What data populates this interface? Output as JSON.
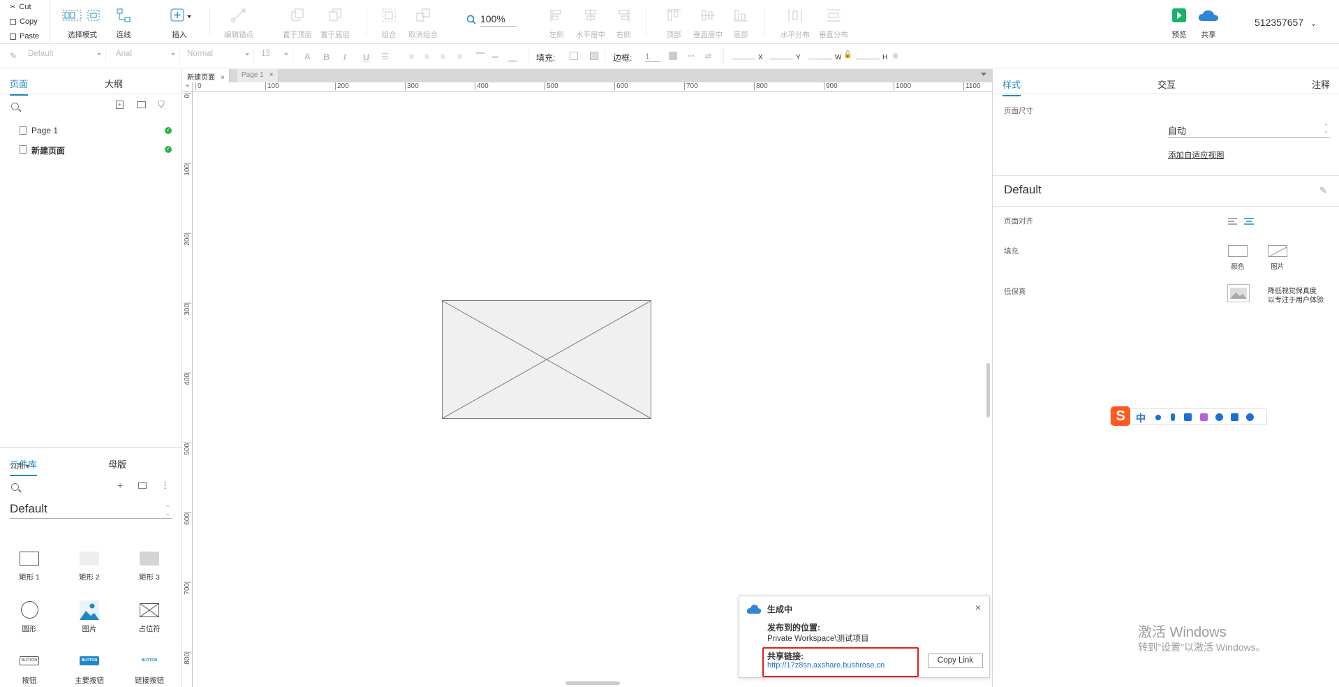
{
  "clipboard": {
    "cut": "Cut",
    "copy": "Copy",
    "paste": "Paste"
  },
  "toolbar": {
    "select_mode": "选择模式",
    "connect": "连线",
    "insert": "插入",
    "edit_points": "编辑锚点",
    "bring_front": "置于顶层",
    "send_back": "置于底层",
    "group": "组合",
    "ungroup": "取消组合",
    "zoom": "100%",
    "align_left": "左侧",
    "align_hcenter": "水平居中",
    "align_right": "右侧",
    "align_top": "顶部",
    "align_vcenter": "垂直居中",
    "align_bottom": "底部",
    "dist_h": "水平分布",
    "dist_v": "垂直分布",
    "preview": "预览",
    "share": "共享",
    "user_id": "512357657"
  },
  "formatbar": {
    "style": "Default",
    "font": "Arial",
    "weight": "Normal",
    "size": "13",
    "fill_label": "填充:",
    "border_label": "边框:",
    "border_value": "1",
    "x_label": "X",
    "y_label": "Y",
    "w_label": "W",
    "h_label": "H"
  },
  "left_panel": {
    "tabs": [
      "页面",
      "大纲"
    ],
    "pages": [
      {
        "name": "Page 1",
        "bold": false
      },
      {
        "name": "新建页面",
        "bold": true
      }
    ],
    "lib_tabs": [
      "元件库",
      "母版"
    ],
    "library": "Default",
    "group": "公用 ▾",
    "widgets": [
      "矩形 1",
      "矩形 2",
      "矩形 3",
      "圆形",
      "图片",
      "占位符",
      "按钮",
      "主要按钮",
      "链接按钮"
    ],
    "button_icon_text": "BUTTON"
  },
  "canvas": {
    "tabs": [
      "新建页面",
      "Page 1"
    ],
    "ruler_h": [
      "0",
      "100",
      "200",
      "300",
      "400",
      "500",
      "600",
      "700",
      "800",
      "900",
      "1000",
      "1100"
    ],
    "ruler_v": [
      "0",
      "100",
      "200",
      "300",
      "400",
      "500",
      "600",
      "700",
      "800"
    ]
  },
  "right_panel": {
    "tabs": [
      "样式",
      "交互",
      "注释"
    ],
    "page_size_label": "页面尺寸",
    "page_size_value": "自动",
    "adaptive_link": "添加自适应视图",
    "style_name": "Default",
    "align_label": "页面对齐",
    "fill_label": "填充",
    "fill_color": "颜色",
    "fill_image": "图片",
    "lofi_label": "低保真",
    "lofi_desc_1": "降低视觉保真度",
    "lofi_desc_2": "以专注于用户体验"
  },
  "ime": {
    "lang": "中"
  },
  "activate": {
    "line1": "激活 Windows",
    "line2": "转到\"设置\"以激活 Windows。"
  },
  "popup": {
    "title": "生成中",
    "location_label": "发布到的位置:",
    "location": "Private Workspace\\测试项目",
    "link_label": "共享链接:",
    "link": "http://17z8sn.axshare.bushrose.cn",
    "copy_button": "Copy Link"
  },
  "colors": {
    "accent": "#1e88c7",
    "highlight": "#e31e1e",
    "link": "#1e73c7",
    "ok": "#2db34a"
  }
}
